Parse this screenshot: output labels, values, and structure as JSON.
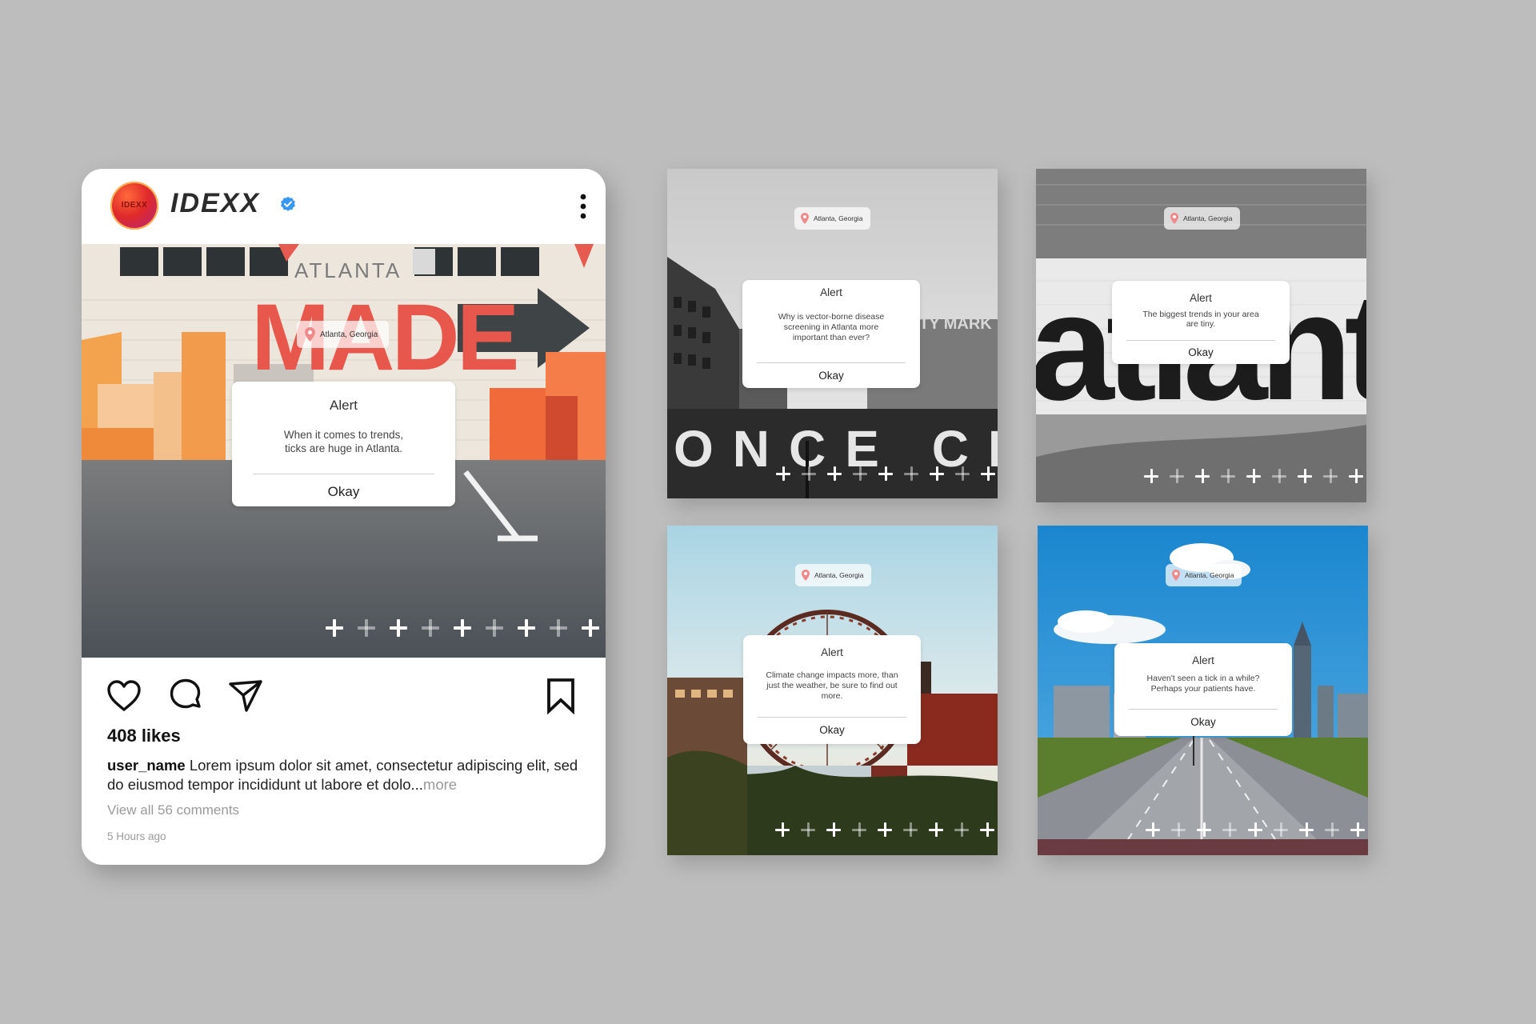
{
  "colors": {
    "canvas": "#bdbdbd",
    "card": "#ffffff",
    "brand_red": "#e02a2a",
    "verified_blue": "#3897f0",
    "pin_pink": "#f08a8a"
  },
  "post": {
    "avatar_text": "IDEXX",
    "brand_name": "IDEXX",
    "verified_icon": "verified-badge-icon",
    "menu_icon": "more-vertical-icon",
    "location": "Atlanta, Georgia",
    "image_text": {
      "city": "ATLANTA",
      "made": "MADE"
    },
    "alert": {
      "title": "Alert",
      "message": "When it comes to trends, ticks are huge in Atlanta.",
      "button": "Okay"
    },
    "actions": [
      "heart-icon",
      "comment-icon",
      "share-icon",
      "bookmark-icon"
    ],
    "likes": "408 likes",
    "caption_user": "user_name",
    "caption_text": " Lorem ipsum dolor sit amet, consectetur adipiscing elit, sed do eiusmod tempor incididunt ut labore et dolo...",
    "caption_more": "more",
    "comments_link": "View all 56 comments",
    "timestamp": "5 Hours ago"
  },
  "tiles": [
    {
      "location": "Atlanta, Georgia",
      "alert": {
        "title": "Alert",
        "message": "Why is vector-borne disease screening in Atlanta more important than ever?",
        "button": "Okay"
      },
      "image_text": {
        "sign": "ONCE CIT",
        "sign2": "TY MARK"
      }
    },
    {
      "location": "Atlanta, Georgia",
      "alert": {
        "title": "Alert",
        "message": "The biggest trends in your area are tiny.",
        "button": "Okay"
      },
      "image_text": {
        "mural": "atlant"
      }
    },
    {
      "location": "Atlanta, Georgia",
      "alert": {
        "title": "Alert",
        "message": "Climate change impacts more, than just the weather, be sure to find out more.",
        "button": "Okay"
      }
    },
    {
      "location": "Atlanta, Georgia",
      "alert": {
        "title": "Alert",
        "message": "Haven't seen a tick in a while? Perhaps your patients have.",
        "button": "Okay"
      }
    }
  ],
  "pager": {
    "icon": "plus-icon",
    "pattern": [
      true,
      false,
      true,
      false,
      true,
      false,
      true,
      false,
      true
    ]
  }
}
